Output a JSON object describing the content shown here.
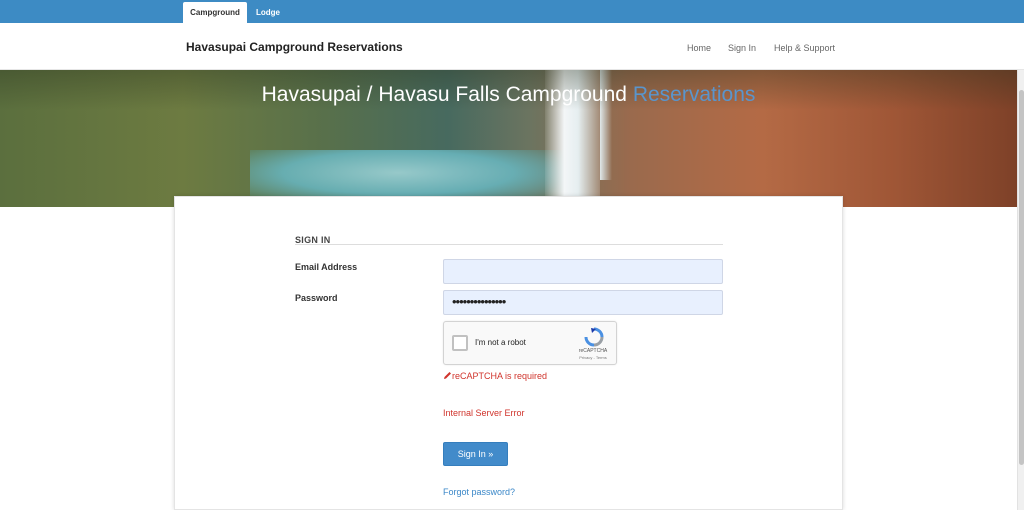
{
  "top_tabs": [
    {
      "label": "Campground",
      "active": true
    },
    {
      "label": "Lodge",
      "active": false
    }
  ],
  "navbar": {
    "brand": "Havasupai Campground Reservations",
    "links": [
      "Home",
      "Sign In",
      "Help & Support"
    ]
  },
  "hero": {
    "title_main": "Havasupai / Havasu Falls Campground ",
    "title_highlight": "Reservations"
  },
  "signin": {
    "section_title": "SIGN IN",
    "email_label": "Email Address",
    "email_value": "",
    "password_label": "Password",
    "password_value": "•••••••••••••••",
    "recaptcha": {
      "checkbox_label": "I'm not a robot",
      "brand": "reCAPTCHA",
      "terms": "Privacy - Terms"
    },
    "recaptcha_error": "reCAPTCHA is required",
    "server_error": "Internal Server Error",
    "submit_label": "Sign In »",
    "forgot_link": "Forgot password?"
  },
  "colors": {
    "topbar": "#3d8bc4",
    "primary_button": "#428bca",
    "error": "#d0342c",
    "link": "#3a87c8",
    "input_bg": "#e8f0fe"
  },
  "icons": [
    "pencil-icon",
    "recaptcha-logo-icon"
  ]
}
